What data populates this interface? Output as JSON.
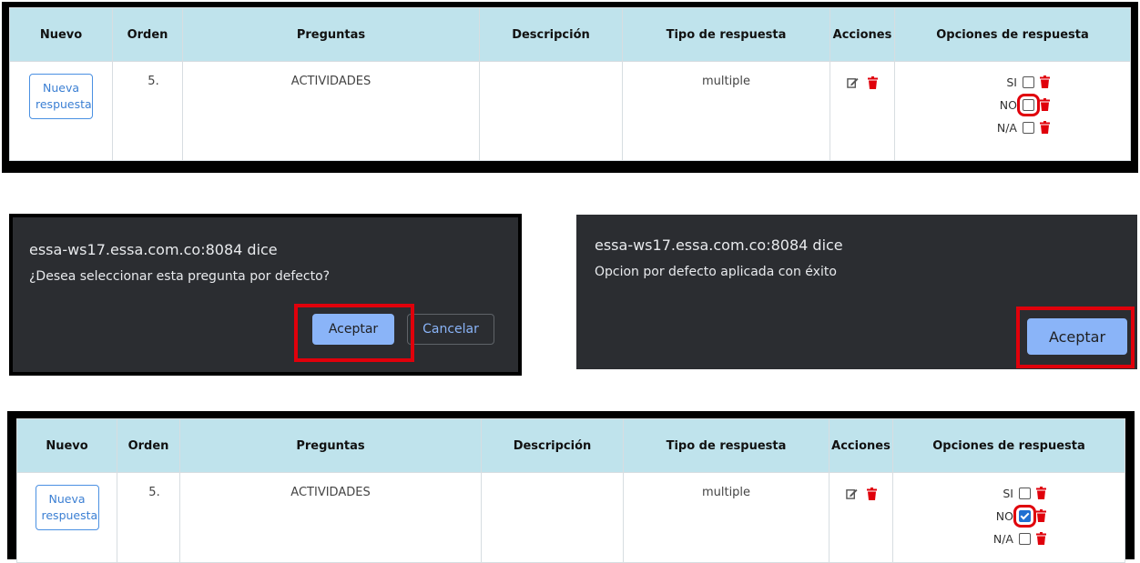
{
  "table": {
    "headers": {
      "nuevo": "Nuevo",
      "orden": "Orden",
      "preguntas": "Preguntas",
      "descripcion": "Descripción",
      "tipo": "Tipo de respuesta",
      "acciones": "Acciones",
      "opciones": "Opciones de respuesta"
    },
    "row": {
      "new_button_label": "Nueva respuesta",
      "orden": "5.",
      "pregunta": "ACTIVIDADES",
      "descripcion": "",
      "tipo": "multiple",
      "options": [
        "SI",
        "NO",
        "N/A"
      ]
    }
  },
  "confirm_dialog": {
    "origin": "essa-ws17.essa.com.co:8084 dice",
    "message": "¿Desea seleccionar esta pregunta por defecto?",
    "accept_label": "Aceptar",
    "cancel_label": "Cancelar"
  },
  "alert_dialog": {
    "origin": "essa-ws17.essa.com.co:8084 dice",
    "message": "Opcion por defecto aplicada con éxito",
    "accept_label": "Aceptar"
  },
  "colors": {
    "header_bg": "#bfe3ec",
    "highlight": "#e0000b",
    "trash": "#e0000b",
    "dialog_bg": "#2b2d31",
    "dialog_button": "#8ab4f8"
  },
  "state": {
    "before_checked_option": "",
    "after_checked_option": "NO"
  }
}
